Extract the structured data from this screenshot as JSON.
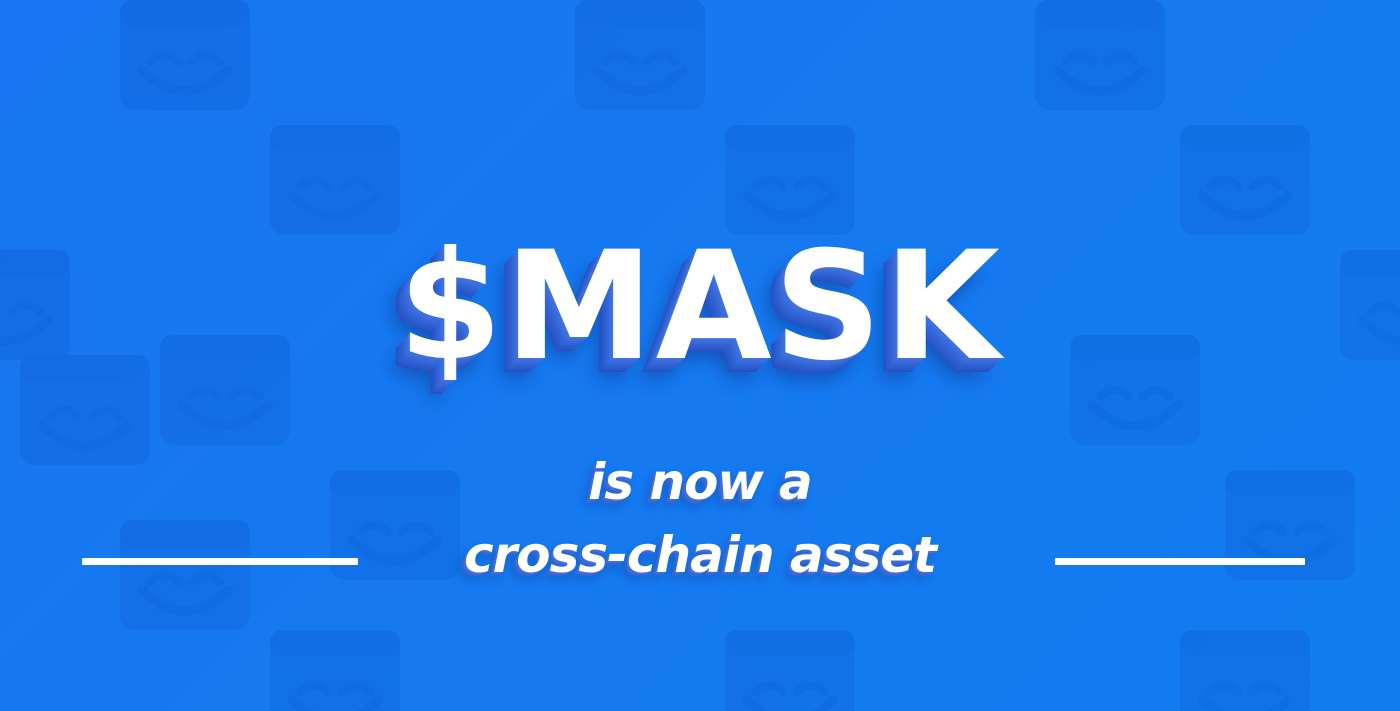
{
  "headline": "$MASK",
  "subline": {
    "line1": "is now a",
    "line2": "cross-chain asset"
  },
  "colors": {
    "background": "#1677ee",
    "text": "#ffffff",
    "shadow": "#2453c4"
  },
  "icons": [
    "mask-logo-icon"
  ]
}
